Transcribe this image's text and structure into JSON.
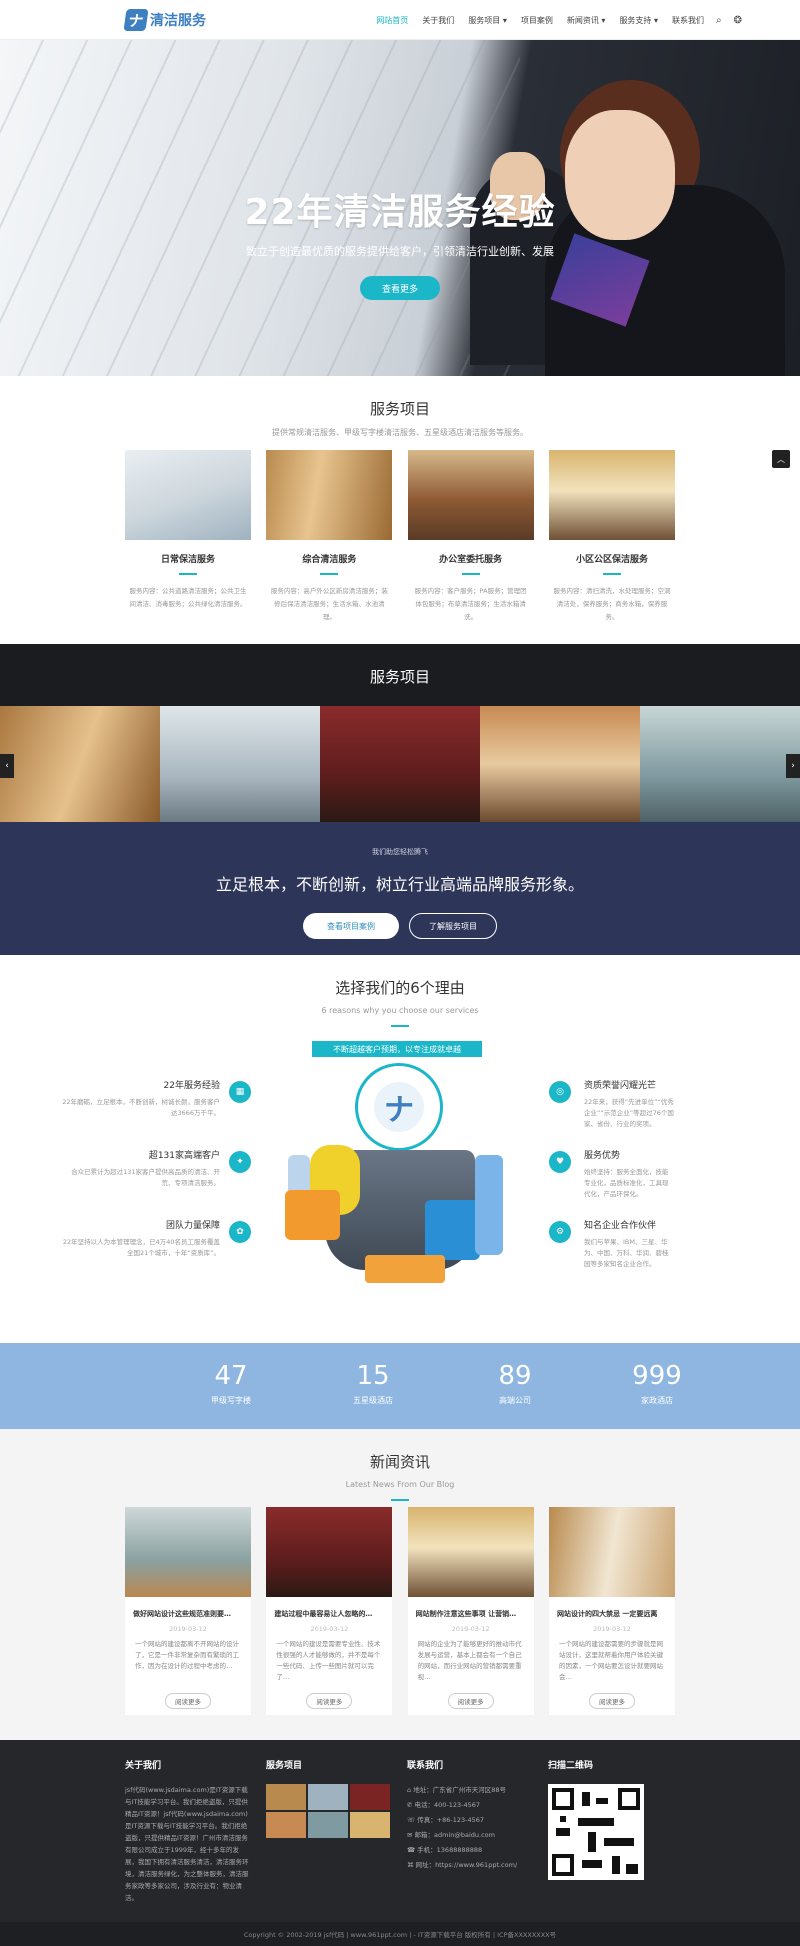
{
  "header": {
    "logo_mark": "ナ",
    "logo_text": "清洁服务",
    "nav": [
      "网站首页",
      "关于我们",
      "服务项目 ▾",
      "项目案例",
      "新闻资讯 ▾",
      "服务支持 ▾",
      "联系我们"
    ],
    "search_icon": "⌕",
    "weibo_icon": "❂"
  },
  "hero": {
    "title": "22年清洁服务经验",
    "subtitle": "致立于创造最优质的服务提供给客户，引领清洁行业创新、发展",
    "button": "查看更多"
  },
  "services": {
    "title": "服务项目",
    "subtitle": "提供常规清洁服务、甲级写字楼清洁服务、五星级酒店清洁服务等服务。",
    "items": [
      {
        "title": "日常保洁服务",
        "desc": "服务内容：公共道路清洁服务；公共卫生间清洁、消毒服务；公共绿化清洁服务。"
      },
      {
        "title": "综合清洁服务",
        "desc": "服务内容：高户外公区新房清洁服务；装修后保洁清洁服务；生活水箱、水池清理。"
      },
      {
        "title": "办公室委托服务",
        "desc": "服务内容：客户服务；PA服务；管理团体包服务；布草清洁服务；生活水箱清洗。"
      },
      {
        "title": "小区公区保洁服务",
        "desc": "服务内容：清扫清洗，水处理服务；空洞清洁处，保养服务；商务水箱，保养服务。"
      }
    ]
  },
  "slider": {
    "title": "服务项目",
    "prev": "‹",
    "next": "›"
  },
  "banner": {
    "small": "我们助您轻松腾飞",
    "big": "立足根本，不断创新，树立行业高端品牌服务形象。",
    "btn1": "查看项目案例",
    "btn2": "了解服务项目"
  },
  "reasons": {
    "title": "选择我们的6个理由",
    "subtitle": "6 reasons why you choose our services",
    "tag": "不断超越客户预期，以专注成就卓越",
    "logo_mark": "ナ",
    "left": [
      {
        "title": "22年服务经验",
        "desc": "22年磨砺，立足根本，不断创新，树诚长颜，服务客户达3666万千平。",
        "icon": "▦"
      },
      {
        "title": "超131家高端客户",
        "desc": "合众已累计为超过131家客户提供高品质的清洁、开荒、专项清洁服务。",
        "icon": "✦"
      },
      {
        "title": "团队力量保障",
        "desc": "22年坚持以人为本管理理念，已4万40名员工服务覆盖全国21个城市，十年“资质库”。",
        "icon": "✿"
      }
    ],
    "right": [
      {
        "title": "资质荣誉闪耀光芒",
        "desc": "22年来，获得“先进单位”“优秀企业”“示范企业”等超过76个国家、省份、行业的奖项。",
        "icon": "◎"
      },
      {
        "title": "服务优势",
        "desc": "始终坚持：服务全面化，技能专业化，品质标准化，工具现代化，产品环保化。",
        "icon": "♥"
      },
      {
        "title": "知名企业合作伙伴",
        "desc": "我们与苹果、IBM、三星、华为、中国、万科、华润、碧桂园等多家知名企业合作。",
        "icon": "⚙"
      }
    ]
  },
  "stats": [
    {
      "num": "47",
      "label": "甲级写字楼"
    },
    {
      "num": "15",
      "label": "五星级酒店"
    },
    {
      "num": "89",
      "label": "高端公司"
    },
    {
      "num": "999",
      "label": "家政酒店"
    }
  ],
  "news": {
    "title": "新闻资讯",
    "subtitle": "Latest News From Our Blog",
    "items": [
      {
        "title": "做好网站设计这些规范准则要…",
        "date": "2019-03-12",
        "desc": "一个网站的建设都离不开网站的设计了，它是一件非常复杂而有繁琐的工作，因为在设计的过程中考虑的…",
        "more": "阅读更多"
      },
      {
        "title": "建站过程中最容易让人忽略的…",
        "date": "2019-03-12",
        "desc": "一个网站的建设是需要专业性、技术性很强的人才能够做的，并不是每个一些代码、上传一些图片就可以完了…",
        "more": "阅读更多"
      },
      {
        "title": "网站制作注意这些事项 让营销…",
        "date": "2019-03-12",
        "desc": "网站的企业为了能够更好的推动市代发展与运营，基本上都会有一个自己的网站，而行业网站的营销都需要重视…",
        "more": "阅读更多"
      },
      {
        "title": "网站设计的四大禁忌 一定要远离",
        "date": "2019-03-12",
        "desc": "一个网站的建设都需要的步骤就是网站设计，这里就帮着你用户体验关键的因素，一个网站要怎设计就要网站会…",
        "more": "阅读更多"
      }
    ]
  },
  "footer": {
    "about_title": "关于我们",
    "about_text": "jsf代码(www.jsdaima.com)是IT资源下载与IT技能学习平台。我们拒绝盗版，只提供精品IT资源！jsf代码(www.jsdaima.com)是IT资源下载与IT技能学习平台。我们拒绝盗版，只提供精品IT资源！广州市清洁服务有限公司成立于1999年，经十多年的发展，我国下拥有清洁服务清洁，清洁服务环境，清洁服务绿化，为之整体服务，清洁服务家政等多家公司，涉及行业有：物业清洁。",
    "services_title": "服务项目",
    "contact_title": "联系我们",
    "contact": [
      "⌂ 地址：广东省广州市天河区88号",
      "✆ 电话：400-123-4567",
      "☏ 传真：+86-123-4567",
      "✉ 邮箱：admin@baidu.com",
      "☎ 手机：13688888888",
      "⌘ 网址：https://www.961ppt.com/"
    ],
    "qr_title": "扫描二维码",
    "copyright": "Copyright © 2002-2019 jsf代码 | www.961ppt.com | - IT资源下载平台 版权所有 | ICP备XXXXXXXX号"
  },
  "back_to_top": "︿"
}
